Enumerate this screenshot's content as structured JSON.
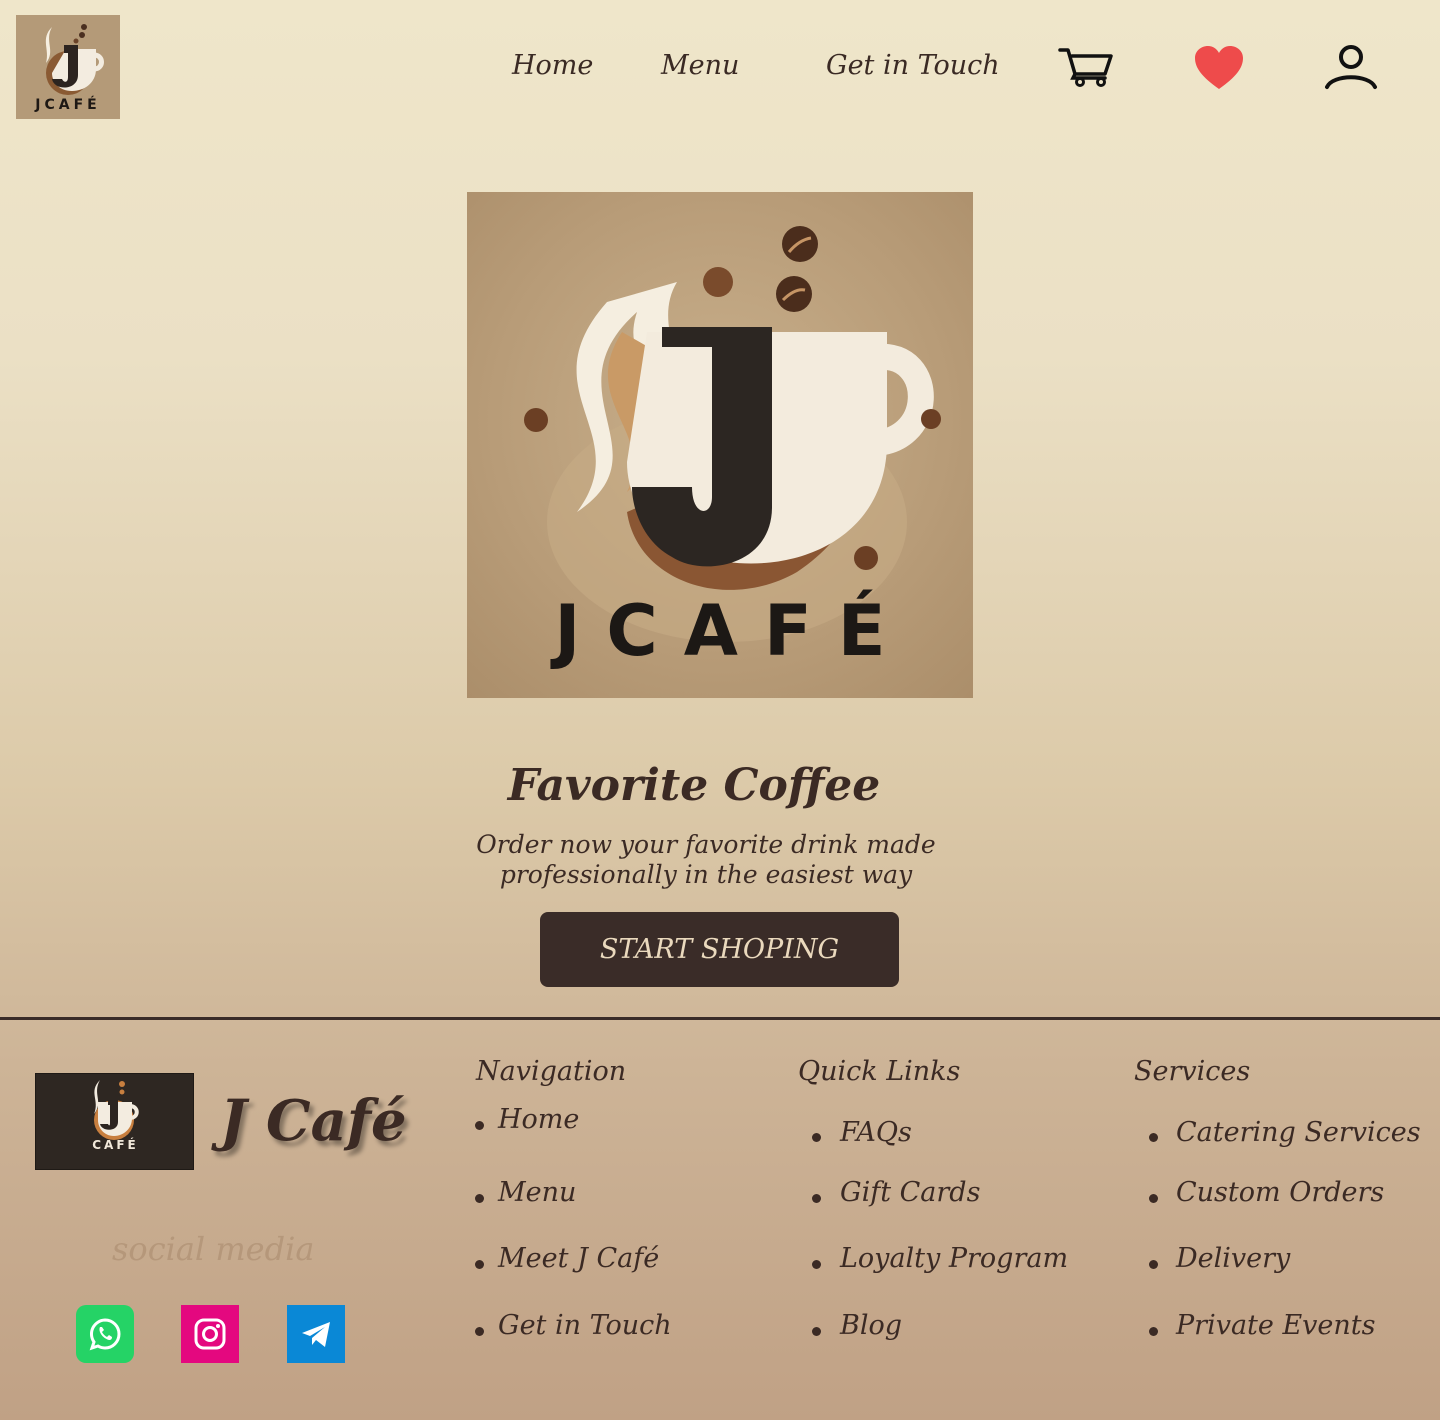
{
  "header": {
    "logo_text": "JCAFÉ",
    "nav": [
      "Home",
      "Menu",
      "Get in Touch"
    ],
    "icons": [
      "cart-icon",
      "heart-icon",
      "user-icon"
    ],
    "heart_color": "#ee4b4b"
  },
  "hero": {
    "logo_text": "JCAFÉ",
    "title": "Favorite Coffee",
    "subtitle": "Order now your favorite drink made professionally in the easiest way",
    "cta": "START SHOPING"
  },
  "footer": {
    "logo_text": "CAFÉ",
    "brand": "J Café",
    "social_label": "social media",
    "social": [
      {
        "icon": "whatsapp-icon",
        "color": "#25d366"
      },
      {
        "icon": "instagram-icon",
        "color": "#e4087f"
      },
      {
        "icon": "telegram-icon",
        "color": "#0a88d6"
      }
    ],
    "navigation": {
      "title": "Navigation",
      "items": [
        "Home",
        "Menu",
        "Meet J Café",
        "Get in Touch"
      ]
    },
    "quick_links": {
      "title": "Quick Links",
      "items": [
        "FAQs",
        "Gift Cards",
        "Loyalty Program",
        "Blog"
      ]
    },
    "services": {
      "title": "Services",
      "items": [
        "Catering Services",
        "Custom Orders",
        "Delivery",
        "Private Events"
      ]
    }
  }
}
